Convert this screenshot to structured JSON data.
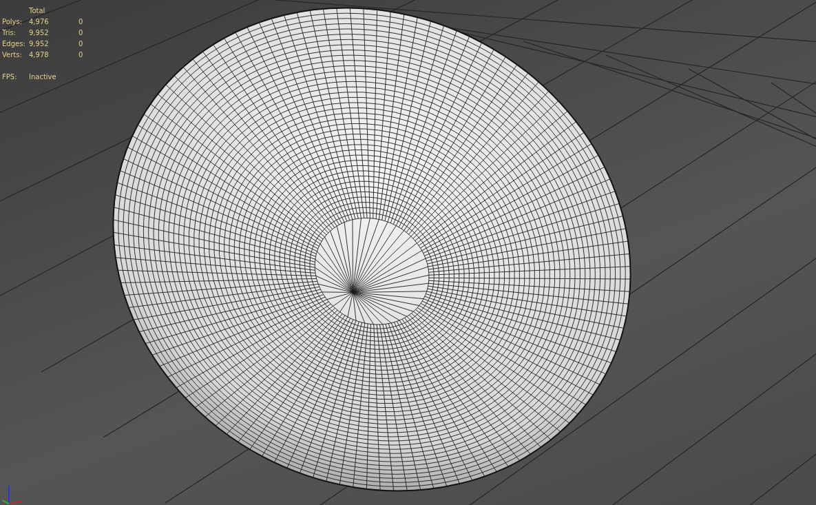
{
  "stats": {
    "header": "Total",
    "rows": [
      {
        "label": "Polys:",
        "total": "4,976",
        "column_3": "0"
      },
      {
        "label": "Tris:",
        "total": "9,952",
        "column_3": "0"
      },
      {
        "label": "Edges:",
        "total": "9,952",
        "column_3": "0"
      },
      {
        "label": "Verts:",
        "total": "4,978",
        "column_3": "0"
      }
    ]
  },
  "fps": {
    "label": "FPS:",
    "value": "Inactive"
  }
}
